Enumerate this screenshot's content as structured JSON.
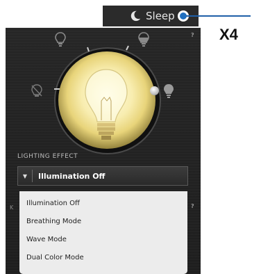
{
  "sleep_tab": {
    "label": "Sleep",
    "icon": "moon-icon"
  },
  "callout": {
    "label": "X4"
  },
  "lighting": {
    "section_label": "LIGHTING EFFECT",
    "selected": "Illumination Off",
    "options": [
      "Illumination Off",
      "Breathing Mode",
      "Wave Mode",
      "Dual Color Mode"
    ]
  },
  "help": {
    "mark": "?"
  },
  "fragments": {
    "left_k": "K"
  },
  "colors": {
    "accent_blue": "#1f6fc0",
    "panel": "#262626",
    "menu": "#ececec"
  }
}
